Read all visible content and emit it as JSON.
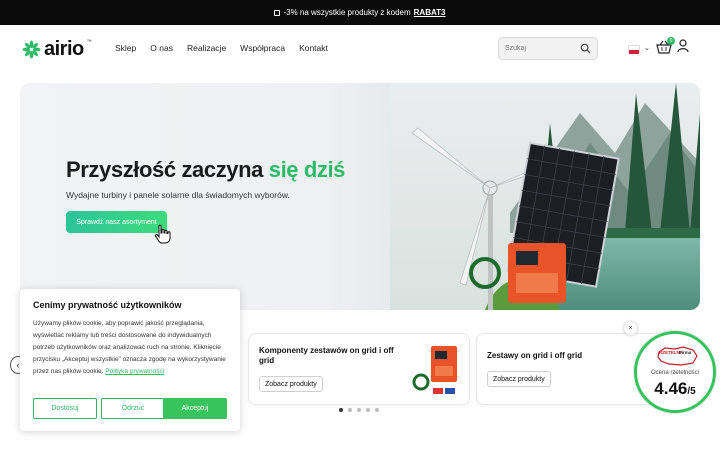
{
  "promo": {
    "icon": "tag-icon",
    "text": "-3% na wszystkie produkty z kodem",
    "code": "RABAT3"
  },
  "logo": {
    "word": "airio",
    "tm": "™"
  },
  "nav": [
    "Sklep",
    "O nas",
    "Realizacje",
    "Współpraca",
    "Kontakt"
  ],
  "search": {
    "placeholder": "Szukaj"
  },
  "header": {
    "cart_count": "0",
    "language_flag": "pl-flag"
  },
  "hero": {
    "title_main": "Przyszłość zaczyna ",
    "title_accent": "się dziś",
    "subtitle": "Wydajne turbiny i panele solarne dla świadomych wyborów.",
    "cta": "Sprawdź nasz asortyment"
  },
  "cards": [
    {
      "title": "Komponenty zestawów on grid i off grid",
      "button": "Zobacz produkty"
    },
    {
      "title": "Zestawy on grid i off grid",
      "button": "Zobacz produkty"
    }
  ],
  "carousel": {
    "left_arrow": "‹",
    "close": "×",
    "pages": 5,
    "active": 0
  },
  "rating": {
    "brand": "RZETELNA",
    "brand2": "Firma",
    "label": "Ocena rzetelności",
    "score": "4.46",
    "max": "/5"
  },
  "cookie": {
    "title": "Cenimy prywatność użytkowników",
    "text": "Używamy plików cookie, aby poprawić jakość przeglądania, wyświetlać reklamy lub treści dostosowane do indywidualnych potrzeb użytkowników oraz analizować ruch na stronie. Kliknięcie przycisku „Akceptuj wszystkie” oznacza zgodę na wykorzystywanie przez nas plików cookie.",
    "link": "Polityka prywatności",
    "reject": "Dostosuj",
    "custom": "Odrzuć",
    "accept": "Akceptuj"
  },
  "colors": {
    "accent": "#2fba6a",
    "promo_bg": "#0b0b0b",
    "cookie_green": "#2db864"
  }
}
